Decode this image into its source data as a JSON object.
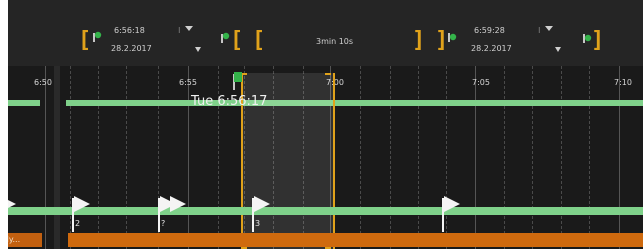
{
  "header": {
    "start_time": "6:56:18",
    "start_date": "28.2.2017",
    "duration": "3min 10s",
    "end_time": "6:59:28",
    "end_date": "28.2.2017"
  },
  "timeline": {
    "ticks": [
      "6:50",
      "6:55",
      "7:00",
      "7:05",
      "7:10"
    ],
    "tooltip": "Tue 6:56:17",
    "flags": [
      "2",
      "?",
      "3"
    ],
    "track_label": "My..."
  },
  "colors": {
    "accent": "#e0a21b",
    "track": "#7fd18a",
    "bar": "#cf6a0e",
    "background": "#1d1d1d"
  }
}
